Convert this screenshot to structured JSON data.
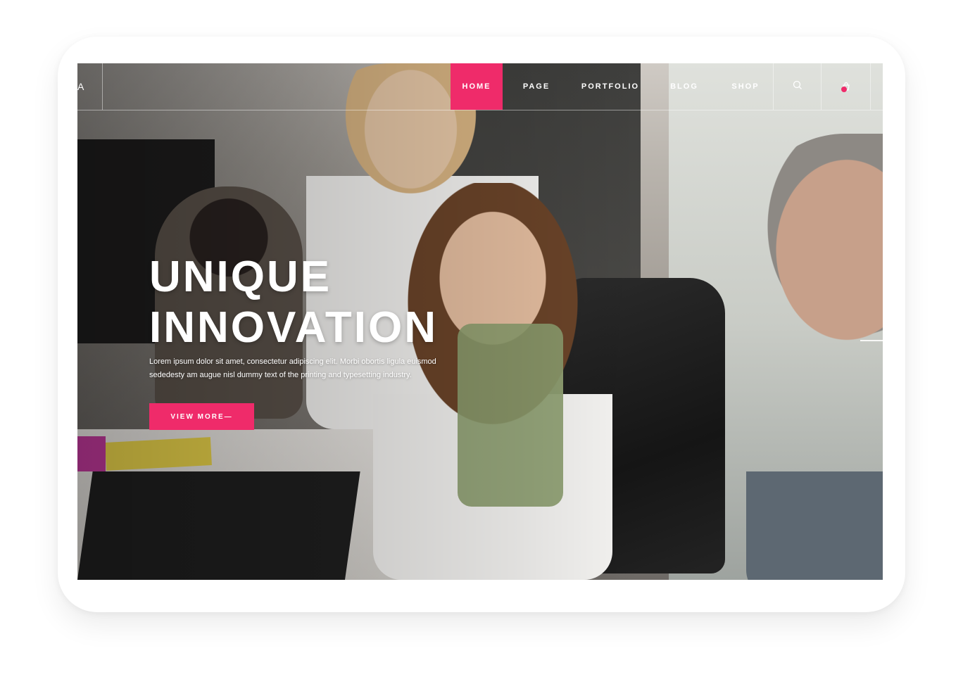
{
  "header": {
    "logo_text": "A",
    "nav": [
      {
        "label": "HOME",
        "active": true
      },
      {
        "label": "PAGE",
        "active": false
      },
      {
        "label": "PORTFOLIO",
        "active": false
      },
      {
        "label": "BLOG",
        "active": false
      },
      {
        "label": "SHOP",
        "active": false
      }
    ],
    "icons": [
      "search-icon",
      "cart-icon"
    ],
    "cart_count": "0"
  },
  "hero": {
    "title_line1": "UNIQUE",
    "title_line2": "INNOVATION",
    "text": "Lorem ipsum dolor sit amet, consectetur adipiscing elit. Morbi obortis ligula euismod sededesty am augue nisl dummy text of the printing and typesetting industry.",
    "button_label": "VIEW MORE—"
  },
  "colors": {
    "accent": "#ef2b6a",
    "text": "#ffffff"
  }
}
